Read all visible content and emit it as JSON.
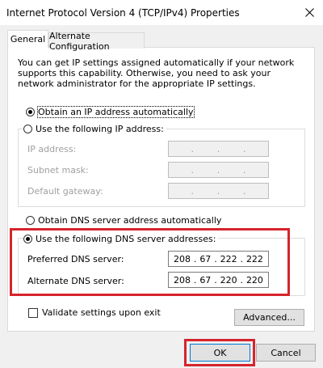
{
  "window": {
    "title": "Internet Protocol Version 4 (TCP/IPv4) Properties"
  },
  "tabs": [
    {
      "label": "General",
      "selected": true
    },
    {
      "label": "Alternate Configuration",
      "selected": false
    }
  ],
  "description": "You can get IP settings assigned automatically if your network supports this capability. Otherwise, you need to ask your network administrator for the appropriate IP settings.",
  "ip": {
    "auto_label": "Obtain an IP address automatically",
    "auto_selected": true,
    "manual_label": "Use the following IP address:",
    "fields": [
      {
        "label": "IP address:",
        "octets": [
          "",
          "",
          "",
          ""
        ]
      },
      {
        "label": "Subnet mask:",
        "octets": [
          "",
          "",
          "",
          ""
        ]
      },
      {
        "label": "Default gateway:",
        "octets": [
          "",
          "",
          "",
          ""
        ]
      }
    ]
  },
  "dns": {
    "auto_label": "Obtain DNS server address automatically",
    "manual_label": "Use the following DNS server addresses:",
    "manual_selected": true,
    "preferred": {
      "label": "Preferred DNS server:",
      "octets": [
        "208",
        "67",
        "222",
        "222"
      ]
    },
    "alternate": {
      "label": "Alternate DNS server:",
      "octets": [
        "208",
        "67",
        "220",
        "220"
      ]
    }
  },
  "validate": {
    "label": "Validate settings upon exit",
    "checked": false
  },
  "buttons": {
    "advanced": "Advanced...",
    "ok": "OK",
    "cancel": "Cancel"
  },
  "colors": {
    "highlight": "#d6242c",
    "focus": "#0078d7"
  }
}
